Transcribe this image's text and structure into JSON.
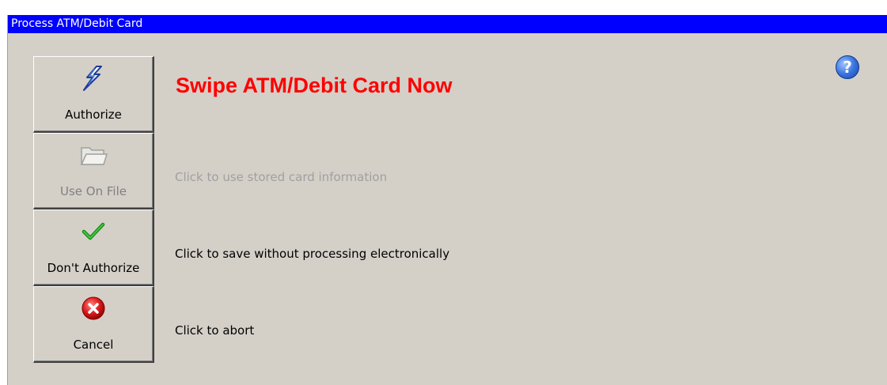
{
  "window": {
    "title": "Process ATM/Debit Card"
  },
  "heading": "Swipe ATM/Debit Card Now",
  "buttons": [
    {
      "label": "Authorize",
      "icon": "lightning-icon",
      "enabled": true,
      "description": ""
    },
    {
      "label": "Use On File",
      "icon": "folder-icon",
      "enabled": false,
      "description": "Click to use stored card information"
    },
    {
      "label": "Don't Authorize",
      "icon": "checkmark-icon",
      "enabled": true,
      "description": "Click to save without processing electronically"
    },
    {
      "label": "Cancel",
      "icon": "cancel-icon",
      "enabled": true,
      "description": "Click to abort"
    }
  ],
  "help": {
    "icon": "help-icon",
    "glyph": "?"
  },
  "colors": {
    "titlebar": "#0000ff",
    "heading": "#ff0000",
    "background": "#d4d0c8",
    "disabled_text": "#a0a0a0"
  }
}
